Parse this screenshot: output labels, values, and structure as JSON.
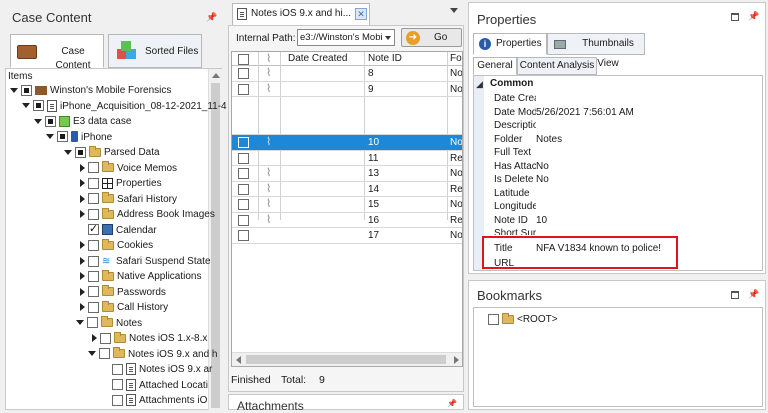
{
  "case_panel": {
    "title": "Case Content",
    "tabs": [
      {
        "label": "Case Content"
      },
      {
        "label": "Sorted Files"
      }
    ],
    "items_header": "Items",
    "tree": [
      {
        "label": "Winston's Mobile Forensics"
      },
      {
        "label": "iPhone_Acquisition_08-12-2021_11-4"
      },
      {
        "label": "E3 data case"
      },
      {
        "label": "iPhone"
      },
      {
        "label": "Parsed Data"
      },
      {
        "label": "Voice Memos"
      },
      {
        "label": "Properties"
      },
      {
        "label": "Safari History"
      },
      {
        "label": "Address Book Images"
      },
      {
        "label": "Calendar"
      },
      {
        "label": "Cookies"
      },
      {
        "label": "Safari Suspend State"
      },
      {
        "label": "Native Applications"
      },
      {
        "label": "Passwords"
      },
      {
        "label": "Call History"
      },
      {
        "label": "Notes"
      },
      {
        "label": "Notes iOS 1.x-8.x"
      },
      {
        "label": "Notes iOS 9.x and h"
      },
      {
        "label": "Notes iOS 9.x ar"
      },
      {
        "label": "Attached Locati"
      },
      {
        "label": "Attachments iO"
      }
    ]
  },
  "notes_panel": {
    "tab_label": "Notes iOS 9.x and hi...",
    "path_label": "Internal Path:",
    "path_value": "e3://Winston's Mobi",
    "go_label": "Go",
    "columns": {
      "date": "Date Created",
      "noteid": "Note ID",
      "folder": "Fold"
    },
    "rows": [
      {
        "id": "8",
        "folder": "Not"
      },
      {
        "id": "9",
        "folder": "Not"
      },
      {
        "id": "",
        "folder": ""
      },
      {
        "id": "10",
        "folder": "Not"
      },
      {
        "id": "11",
        "folder": "Rec"
      },
      {
        "id": "13",
        "folder": "Not"
      },
      {
        "id": "14",
        "folder": "Rec"
      },
      {
        "id": "15",
        "folder": "Not"
      },
      {
        "id": "16",
        "folder": "Rec"
      },
      {
        "id": "17",
        "folder": "Not"
      }
    ],
    "status_text": "Finished",
    "total_label": "Total:",
    "total_value": "9",
    "attachments_title": "Attachments"
  },
  "properties_panel": {
    "title": "Properties",
    "tabs": [
      {
        "label": "Properties"
      },
      {
        "label": "Thumbnails View"
      }
    ],
    "subtabs": [
      {
        "label": "General"
      },
      {
        "label": "Content Analysis"
      }
    ],
    "section": "Common",
    "rows": [
      {
        "key": "Date Crea",
        "value": ""
      },
      {
        "key": "Date Mod",
        "value": "5/26/2021  7:56:01 AM"
      },
      {
        "key": "Descriptio",
        "value": ""
      },
      {
        "key": "Folder",
        "value": "Notes"
      },
      {
        "key": "Full Text",
        "value": ""
      },
      {
        "key": "Has Attac",
        "value": "No"
      },
      {
        "key": "Is Delete",
        "value": "No"
      },
      {
        "key": "Latitude",
        "value": ""
      },
      {
        "key": "Longitude",
        "value": ""
      },
      {
        "key": "Note ID",
        "value": "10"
      },
      {
        "key": "Short Sur",
        "value": ""
      },
      {
        "key": "Title",
        "value": "NFA V1834 known to police!"
      },
      {
        "key": "URL",
        "value": ""
      }
    ],
    "highlight_color": "#e0141c"
  },
  "bookmarks_panel": {
    "title": "Bookmarks",
    "root_label": "<ROOT>"
  },
  "colors": {
    "selection": "#1e88d8",
    "accent_tab": "#3a6fb0"
  }
}
